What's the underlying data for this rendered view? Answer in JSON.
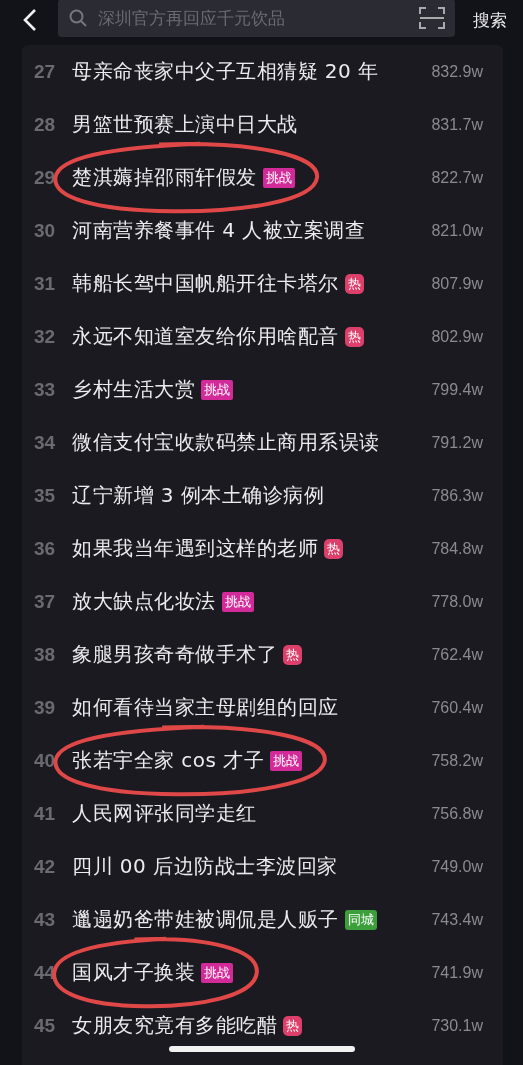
{
  "search": {
    "placeholder": "深圳官方再回应千元饮品",
    "button": "搜索"
  },
  "rows": [
    {
      "rank": "27",
      "title": "母亲命丧家中父子互相猜疑 20 年",
      "views": "832.9w",
      "circled": false
    },
    {
      "rank": "28",
      "title": "男篮世预赛上演中日大战",
      "views": "831.7w",
      "circled": false
    },
    {
      "rank": "29",
      "title": "楚淇薅掉邵雨轩假发",
      "tag": {
        "kind": "challenge",
        "label": "挑战",
        "color": "#d22a98"
      },
      "views": "822.7w",
      "circled": true
    },
    {
      "rank": "30",
      "title": "河南营养餐事件 4 人被立案调查",
      "views": "821.0w",
      "circled": false
    },
    {
      "rank": "31",
      "title": "韩船长驾中国帆船开往卡塔尔",
      "tag": {
        "kind": "hot",
        "label": "热",
        "color": "#dc3f6a"
      },
      "views": "807.9w",
      "circled": false
    },
    {
      "rank": "32",
      "title": "永远不知道室友给你用啥配音",
      "tag": {
        "kind": "hot",
        "label": "热",
        "color": "#dc3f6a"
      },
      "views": "802.9w",
      "circled": false
    },
    {
      "rank": "33",
      "title": "乡村生活大赏",
      "tag": {
        "kind": "challenge",
        "label": "挑战",
        "color": "#d22a98"
      },
      "views": "799.4w",
      "circled": false
    },
    {
      "rank": "34",
      "title": "微信支付宝收款码禁止商用系误读",
      "views": "791.2w",
      "circled": false
    },
    {
      "rank": "35",
      "title": "辽宁新增 3 例本土确诊病例",
      "views": "786.3w",
      "circled": false
    },
    {
      "rank": "36",
      "title": "如果我当年遇到这样的老师",
      "tag": {
        "kind": "hot",
        "label": "热",
        "color": "#dc3f6a"
      },
      "views": "784.8w",
      "circled": false
    },
    {
      "rank": "37",
      "title": "放大缺点化妆法",
      "tag": {
        "kind": "challenge",
        "label": "挑战",
        "color": "#d22a98"
      },
      "views": "778.0w",
      "circled": false
    },
    {
      "rank": "38",
      "title": "象腿男孩奇奇做手术了",
      "tag": {
        "kind": "hot",
        "label": "热",
        "color": "#dc3f6a"
      },
      "views": "762.4w",
      "circled": false
    },
    {
      "rank": "39",
      "title": "如何看待当家主母剧组的回应",
      "views": "760.4w",
      "circled": false
    },
    {
      "rank": "40",
      "title": "张若宇全家 cos 才子",
      "tag": {
        "kind": "challenge",
        "label": "挑战",
        "color": "#d22a98"
      },
      "views": "758.2w",
      "circled": true
    },
    {
      "rank": "41",
      "title": "人民网评张同学走红",
      "views": "756.8w",
      "circled": false
    },
    {
      "rank": "42",
      "title": "四川 00 后边防战士李波回家",
      "views": "749.0w",
      "circled": false
    },
    {
      "rank": "43",
      "title": "邋遢奶爸带娃被调侃是人贩子",
      "tag": {
        "kind": "local",
        "label": "同城",
        "color": "#3c9f3c"
      },
      "views": "743.4w",
      "circled": false
    },
    {
      "rank": "44",
      "title": "国风才子换装",
      "tag": {
        "kind": "challenge",
        "label": "挑战",
        "color": "#d22a98"
      },
      "views": "741.9w",
      "circled": true
    },
    {
      "rank": "45",
      "title": "女朋友究竟有多能吃醋",
      "tag": {
        "kind": "hot",
        "label": "热",
        "color": "#dc3f6a"
      },
      "views": "730.1w",
      "circled": false
    }
  ]
}
